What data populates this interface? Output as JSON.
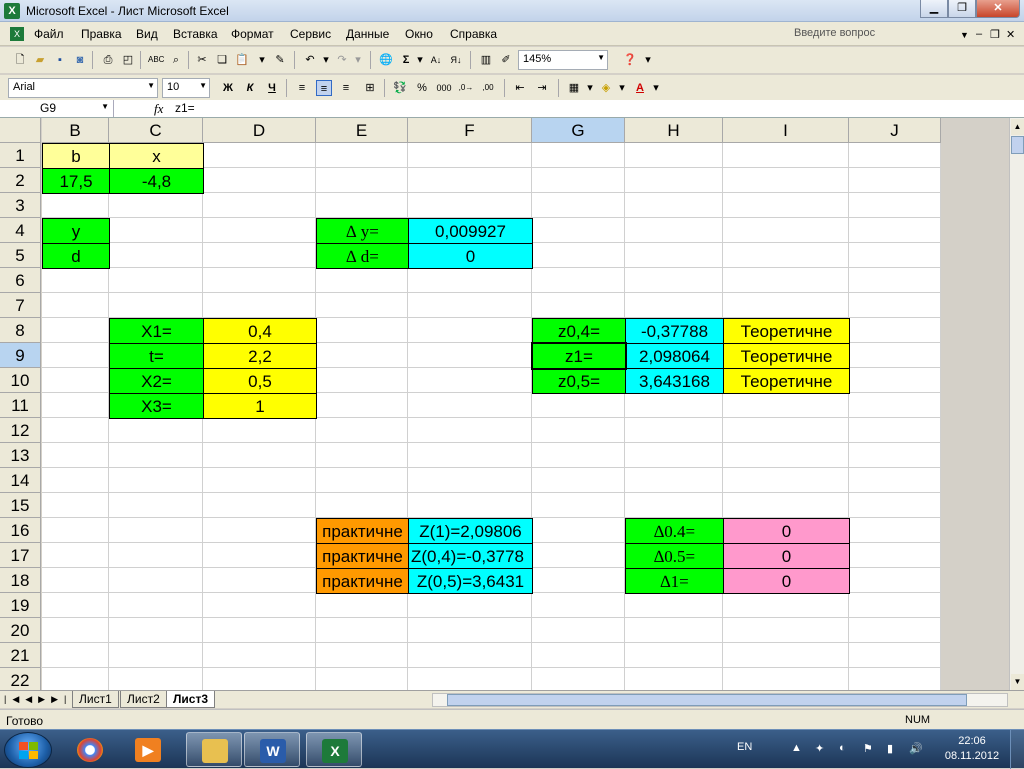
{
  "window": {
    "title": "Microsoft Excel - Лист Microsoft Excel",
    "app_icon": "excel-icon",
    "minimize_icon": "minimize-icon",
    "restore_icon": "restore-icon",
    "close_icon": "close-icon"
  },
  "menu": {
    "items": [
      "Файл",
      "Правка",
      "Вид",
      "Вставка",
      "Формат",
      "Сервис",
      "Данные",
      "Окно",
      "Справка"
    ],
    "ask_placeholder": "Введите вопрос"
  },
  "toolbar": {
    "zoom": "145%"
  },
  "format_toolbar": {
    "font": "Arial",
    "size": "10",
    "bold": "Ж",
    "italic": "К",
    "underline": "Ч",
    "percent": "%",
    "thousands": "000"
  },
  "formula_bar": {
    "name_box": "G9",
    "fx": "fx",
    "value": "z1="
  },
  "columns": [
    "B",
    "C",
    "D",
    "E",
    "F",
    "G",
    "H",
    "I",
    "J"
  ],
  "selected_column": "G",
  "rows": [
    "1",
    "2",
    "3",
    "4",
    "5",
    "6",
    "7",
    "8",
    "9",
    "10",
    "11",
    "12",
    "13",
    "14",
    "15",
    "16",
    "17",
    "18",
    "19",
    "20",
    "21",
    "22"
  ],
  "selected_row": "9",
  "cells": {
    "B1": "b",
    "C1": "x",
    "B2": "17,5",
    "C2": "-4,8",
    "B4": "y",
    "B5": "d",
    "E4": "∆ y=",
    "F4": "0,009927",
    "E5": "∆ d=",
    "F5": "0",
    "C8": "X1=",
    "D8": "0,4",
    "C9": "t=",
    "D9": "2,2",
    "C10": "X2=",
    "D10": "0,5",
    "C11": "X3=",
    "D11": "1",
    "G8": "z0,4=",
    "H8": "-0,37788",
    "I8": "Теоретичне",
    "G9": "z1=",
    "H9": "2,098064",
    "I9": "Теоретичне",
    "G10": "z0,5=",
    "H10": "3,643168",
    "I10": "Теоретичне",
    "E16": "практичне",
    "F16": "Z(1)=2,09806",
    "E17": "практичне",
    "F17": "Z(0,4)=-0,3778",
    "E18": "практичне",
    "F18": "Z(0,5)=3,6431",
    "H16": "∆0.4=",
    "I16": "0",
    "H17": "∆0.5=",
    "I17": "0",
    "H18": "∆1=",
    "I18": "0"
  },
  "sheets": [
    "Лист1",
    "Лист2",
    "Лист3"
  ],
  "active_sheet": "Лист3",
  "status": {
    "ready": "Готово",
    "num": "NUM"
  },
  "tray": {
    "lang": "EN",
    "time": "22:06",
    "date": "08.11.2012"
  },
  "colors": {
    "light_yellow": "#ffff99",
    "yellow": "#ffff00",
    "green": "#00ff00",
    "cyan": "#00ffff",
    "orange": "#ff9900",
    "pink": "#ff99cc",
    "selection": "#b8d4f0"
  }
}
